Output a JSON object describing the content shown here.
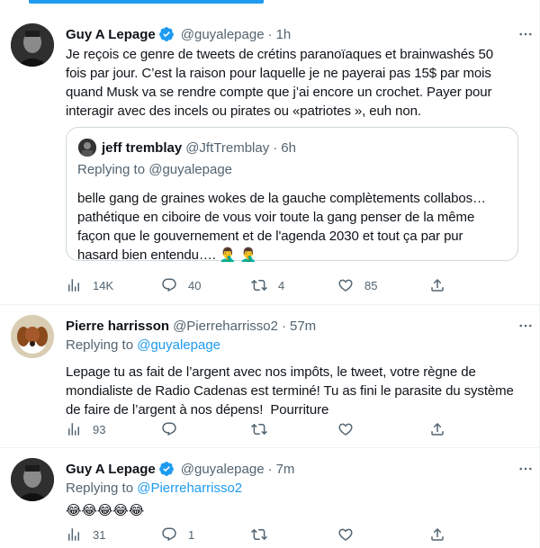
{
  "tweets": [
    {
      "name": "Guy A Lepage",
      "handle": "@guyalepage",
      "time": "1h",
      "verified": true,
      "text": "Je reçois ce genre de tweets de crétins paranoïaques et brainwashés 50\nfois par jour. C’est la raison pour laquelle je ne payerai pas 15$ par mois\nquand Musk va se rendre compte que j’ai encore un crochet. Payer pour\ninteragir avec des incels ou pirates ou «patriotes », euh non.",
      "quote": {
        "name": "jeff tremblay",
        "handle": "@JftTremblay",
        "time": "6h",
        "replying_prefix": "Replying to",
        "replying_to": "@guyalepage",
        "text": "belle gang de graines wokes de la gauche complètements collabos…\npathétique en ciboire de vous voir toute la gang penser de la même\nfaçon que le gouvernement et de l'agenda 2030 et tout ça par pur\nhasard bien entendu…. 🤦‍♂️ 🤦‍♂️"
      },
      "stats": {
        "views": "14K",
        "replies": "40",
        "retweets": "4",
        "likes": "85"
      }
    },
    {
      "name": "Pierre harrisson",
      "handle": "@Pierreharrisso2",
      "time": "57m",
      "verified": false,
      "replying_prefix": "Replying to",
      "replying_to": "@guyalepage",
      "text": "Lepage tu as fait de l’argent avec nos impôts, le tweet, votre règne de\nmondialiste de Radio Cadenas est terminé! Tu as fini le parasite du système\nde faire de l’argent à nos dépens!  Pourriture",
      "stats": {
        "views": "93",
        "replies": "",
        "retweets": "",
        "likes": ""
      }
    },
    {
      "name": "Guy A Lepage",
      "handle": "@guyalepage",
      "time": "7m",
      "verified": true,
      "replying_prefix": "Replying to",
      "replying_to": "@Pierreharrisso2",
      "text": "😂😂😂😂😂",
      "stats": {
        "views": "31",
        "replies": "1",
        "retweets": "",
        "likes": ""
      }
    }
  ],
  "colors": {
    "accent": "#1d9bf0",
    "secondary_text": "#536471",
    "border": "#cfd9de"
  },
  "icons": [
    "more-icon",
    "verified-icon",
    "views-icon",
    "reply-icon",
    "retweet-icon",
    "like-icon",
    "share-icon"
  ]
}
